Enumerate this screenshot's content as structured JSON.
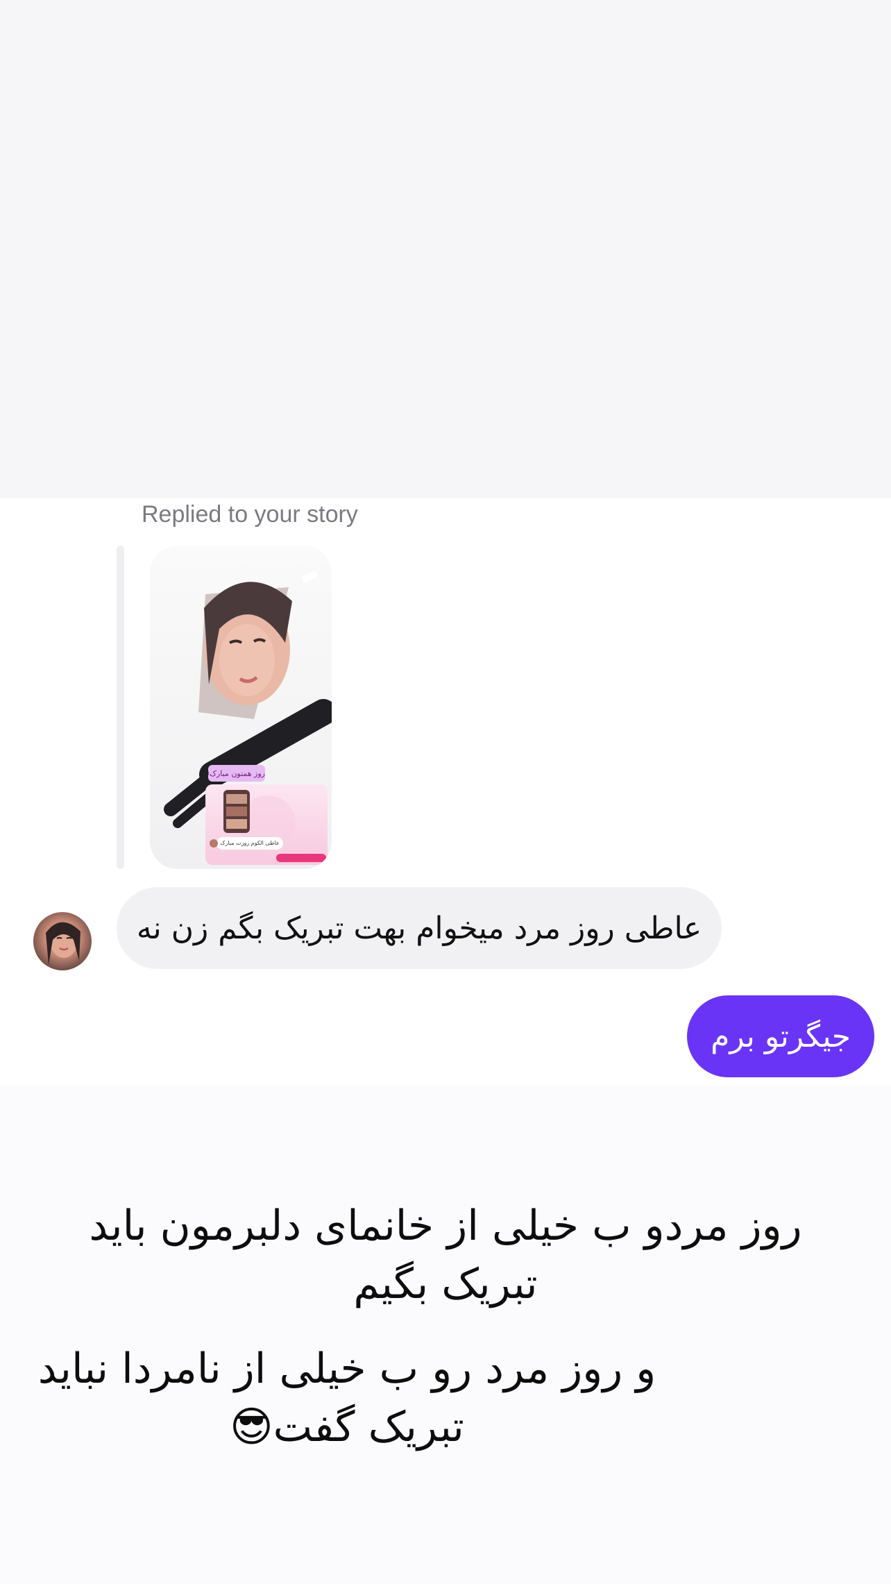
{
  "conversation": {
    "reply_context_label": "Replied to your story",
    "story_preview": {
      "banner_text": "روز همتون مبارک😍😍😜",
      "inner_message": "عاطی الکوم روزت مبارک"
    },
    "messages": [
      {
        "direction": "incoming",
        "text": "عاطی روز مرد میخوام بهت تبریک بگم زن نه"
      },
      {
        "direction": "outgoing",
        "text": "جیگرتو برم"
      }
    ]
  },
  "overlay_captions": {
    "line1": "روز مردو ب خیلی از خانمای دلبرمون باید تبریک بگیم",
    "line2": "و روز مرد رو ب خیلی از نامردا نباید تبریک گفت😎"
  },
  "colors": {
    "outgoing_bubble": "#6a34f6",
    "incoming_bubble": "#f1f1f3",
    "label_text": "#7a7a80"
  }
}
